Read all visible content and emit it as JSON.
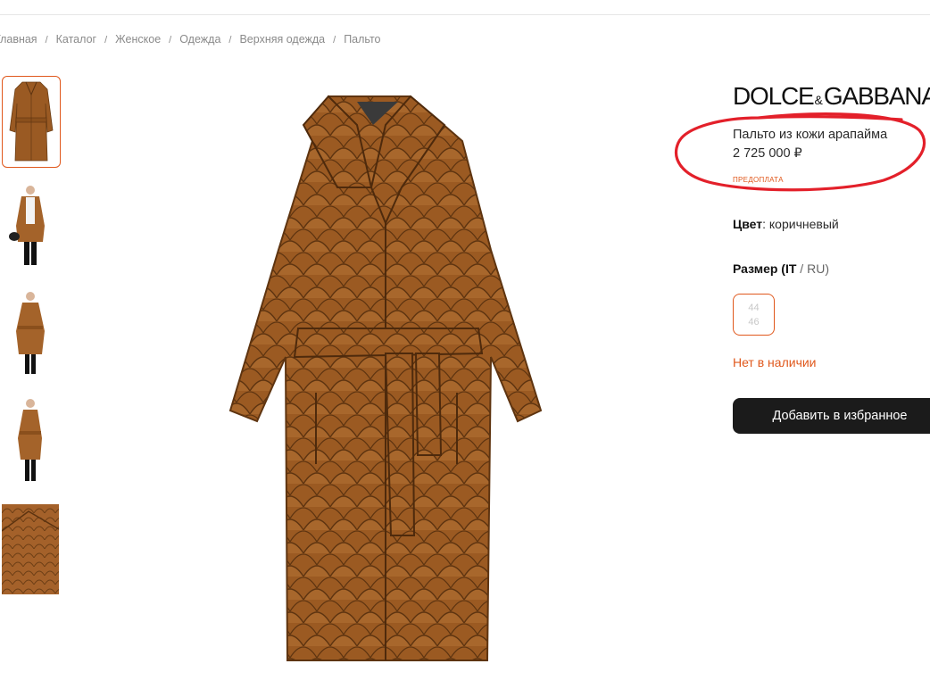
{
  "breadcrumb": {
    "items": [
      "Главная",
      "Каталог",
      "Женское",
      "Одежда",
      "Верхняя одежда",
      "Пальто"
    ],
    "separator": "/"
  },
  "product": {
    "brand_left": "DOLCE",
    "brand_amp": "&",
    "brand_right": "GABBANA",
    "name": "Пальто из кожи арапайма",
    "price": "2 725 000 ₽",
    "prepay": "ПРЕДОПЛАТА",
    "color_label": "Цвет",
    "color_value": ": коричневый",
    "size_label": "Размер (IT",
    "size_sep": " / ",
    "size_alt": "RU)",
    "size_it": "44",
    "size_ru": "46",
    "stock": "Нет в наличии",
    "favorite_button": "Добавить в избранное"
  },
  "icons": {
    "thumbs": [
      "coat-front-thumb",
      "model-open-thumb",
      "model-belted-thumb",
      "model-side-thumb",
      "leather-detail-thumb"
    ]
  },
  "colors": {
    "accent": "#e0581c",
    "leather": "#9a5a23",
    "button": "#1b1b1b",
    "annotation": "#e3202a"
  }
}
